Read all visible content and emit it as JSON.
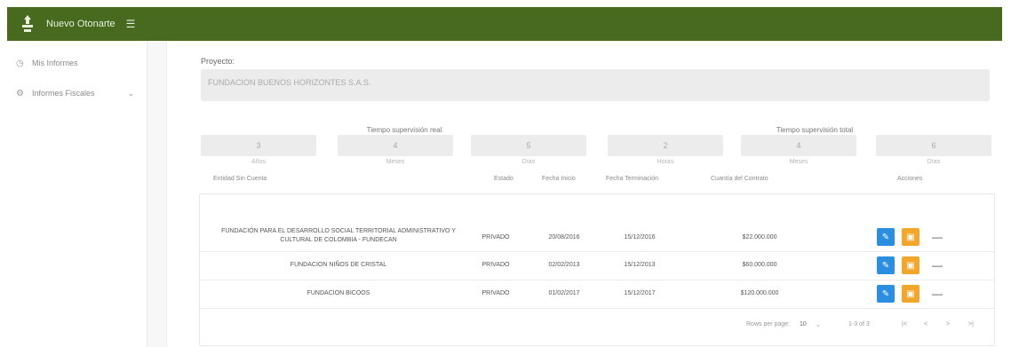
{
  "topbar": {
    "title": "Nuevo Otonarte",
    "menu_icon": "menu-icon",
    "color": "#476a1e"
  },
  "sidebar": {
    "items": [
      {
        "label": "Mis Informes",
        "icon": "clock-icon"
      },
      {
        "label": "Informes Fiscales",
        "icon": "gear-icon",
        "chevron": "chevron-down-icon"
      }
    ]
  },
  "main": {
    "proyecto_label": "Proyecto:",
    "proyecto_value": "FUNDACION BUENOS HORIZONTES S.A.S.",
    "group_left": "Tiempo supervisión real",
    "group_right": "Tiempo supervisión total",
    "boxes": [
      {
        "value": "3",
        "caption": "Años"
      },
      {
        "value": "4",
        "caption": "Meses"
      },
      {
        "value": "5",
        "caption": "Días"
      },
      {
        "value": "2",
        "caption": "Horas"
      },
      {
        "value": "4",
        "caption": "Meses"
      },
      {
        "value": "6",
        "caption": "Días"
      }
    ]
  },
  "table": {
    "headers": [
      "Entidad Sin Cuenta",
      "Estado",
      "Fecha Inicio",
      "Fecha Terminación",
      "Cuantía del Contrato",
      "Acciones"
    ],
    "rows": [
      {
        "entity": "FUNDACIÓN PARA EL DESARROLLO SOCIAL TERRITORIAL ADMINISTRATIVO Y CULTURAL DE COLOMBIA - FUNDECAN",
        "estado": "PRIVADO",
        "inicio": "20/08/2016",
        "terminacion": "15/12/2016",
        "cuantia": "$22.000.000"
      },
      {
        "entity": "FUNDACION NIÑOS DE CRISTAL",
        "estado": "PRIVADO",
        "inicio": "02/02/2013",
        "terminacion": "15/12/2013",
        "cuantia": "$60.000.000"
      },
      {
        "entity": "FUNDACION BICOOS",
        "estado": "PRIVADO",
        "inicio": "01/02/2017",
        "terminacion": "15/12/2017",
        "cuantia": "$120.000.000"
      }
    ]
  },
  "pagination": {
    "rows_label": "Rows per page:",
    "rows_value": "10",
    "range": "1-3 of 3"
  }
}
